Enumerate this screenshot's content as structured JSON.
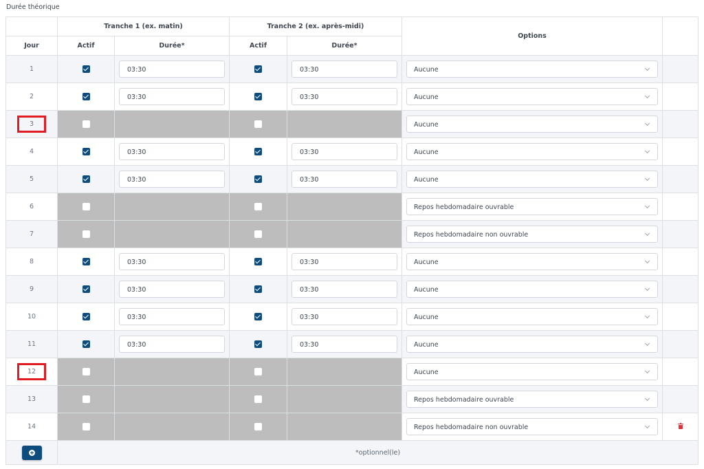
{
  "section_title": "Durée théorique",
  "headers": {
    "jour": "Jour",
    "tranche1": "Tranche 1 (ex. matin)",
    "tranche2": "Tranche 2 (ex. après-midi)",
    "actif": "Actif",
    "duree": "Durée*",
    "options": "Options"
  },
  "rows": [
    {
      "day": "1",
      "marked": false,
      "t1_active": true,
      "t1_duration": "03:30",
      "t2_active": true,
      "t2_duration": "03:30",
      "option": "Aucune",
      "deletable": false
    },
    {
      "day": "2",
      "marked": false,
      "t1_active": true,
      "t1_duration": "03:30",
      "t2_active": true,
      "t2_duration": "03:30",
      "option": "Aucune",
      "deletable": false
    },
    {
      "day": "3",
      "marked": true,
      "t1_active": false,
      "t1_duration": "",
      "t2_active": false,
      "t2_duration": "",
      "option": "Aucune",
      "deletable": false
    },
    {
      "day": "4",
      "marked": false,
      "t1_active": true,
      "t1_duration": "03:30",
      "t2_active": true,
      "t2_duration": "03:30",
      "option": "Aucune",
      "deletable": false
    },
    {
      "day": "5",
      "marked": false,
      "t1_active": true,
      "t1_duration": "03:30",
      "t2_active": true,
      "t2_duration": "03:30",
      "option": "Aucune",
      "deletable": false
    },
    {
      "day": "6",
      "marked": false,
      "t1_active": false,
      "t1_duration": "",
      "t2_active": false,
      "t2_duration": "",
      "option": "Repos hebdomadaire ouvrable",
      "deletable": false
    },
    {
      "day": "7",
      "marked": false,
      "t1_active": false,
      "t1_duration": "",
      "t2_active": false,
      "t2_duration": "",
      "option": "Repos hebdomadaire non ouvrable",
      "deletable": false
    },
    {
      "day": "8",
      "marked": false,
      "t1_active": true,
      "t1_duration": "03:30",
      "t2_active": true,
      "t2_duration": "03:30",
      "option": "Aucune",
      "deletable": false
    },
    {
      "day": "9",
      "marked": false,
      "t1_active": true,
      "t1_duration": "03:30",
      "t2_active": true,
      "t2_duration": "03:30",
      "option": "Aucune",
      "deletable": false
    },
    {
      "day": "10",
      "marked": false,
      "t1_active": true,
      "t1_duration": "03:30",
      "t2_active": true,
      "t2_duration": "03:30",
      "option": "Aucune",
      "deletable": false
    },
    {
      "day": "11",
      "marked": false,
      "t1_active": true,
      "t1_duration": "03:30",
      "t2_active": true,
      "t2_duration": "03:30",
      "option": "Aucune",
      "deletable": false
    },
    {
      "day": "12",
      "marked": true,
      "t1_active": false,
      "t1_duration": "",
      "t2_active": false,
      "t2_duration": "",
      "option": "Aucune",
      "deletable": false
    },
    {
      "day": "13",
      "marked": false,
      "t1_active": false,
      "t1_duration": "",
      "t2_active": false,
      "t2_duration": "",
      "option": "Repos hebdomadaire ouvrable",
      "deletable": false
    },
    {
      "day": "14",
      "marked": false,
      "t1_active": false,
      "t1_duration": "",
      "t2_active": false,
      "t2_duration": "",
      "option": "Repos hebdomadaire non ouvrable",
      "deletable": true
    }
  ],
  "footer": {
    "note": "*optionnel(le)"
  },
  "icons": {
    "checkbox": "checkbox-icon",
    "chevron": "chevron-down-icon",
    "delete": "trash-icon",
    "add": "plus-circle-icon"
  },
  "colors": {
    "accent": "#0f4c7e",
    "inactive_cell": "#bdbdbd",
    "highlight": "#e01b22",
    "delete": "#e2333b"
  }
}
